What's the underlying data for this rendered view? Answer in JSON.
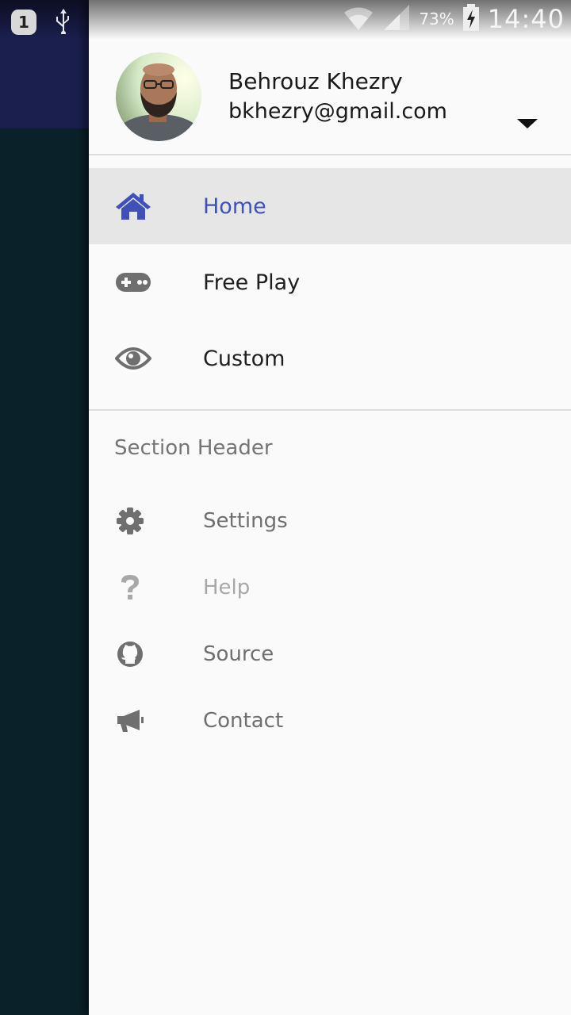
{
  "status_bar": {
    "notification_badge": "1",
    "battery_percent": "73%",
    "time": "14:40",
    "icons": [
      "notification-1-icon",
      "usb-icon",
      "wifi-icon",
      "signal-icon",
      "battery-charging-icon"
    ]
  },
  "profile": {
    "name": "Behrouz Khezry",
    "email": "bkhezry@gmail.com"
  },
  "nav": {
    "primary": [
      {
        "label": "Home",
        "icon": "home-icon",
        "active": true
      },
      {
        "label": "Free Play",
        "icon": "gamepad-icon",
        "active": false
      },
      {
        "label": "Custom",
        "icon": "eye-icon",
        "active": false
      }
    ],
    "section_header": "Section Header",
    "secondary": [
      {
        "label": "Settings",
        "icon": "gear-icon"
      },
      {
        "label": "Help",
        "icon": "question-icon",
        "disabled": true
      },
      {
        "label": "Source",
        "icon": "github-icon"
      },
      {
        "label": "Contact",
        "icon": "megaphone-icon"
      }
    ]
  },
  "colors": {
    "accent": "#3f51b5",
    "drawer_bg": "#fafafa",
    "active_bg": "#e6e6e6",
    "toolbar_bg": "#1b1f4e",
    "content_bg": "#0b2129"
  }
}
